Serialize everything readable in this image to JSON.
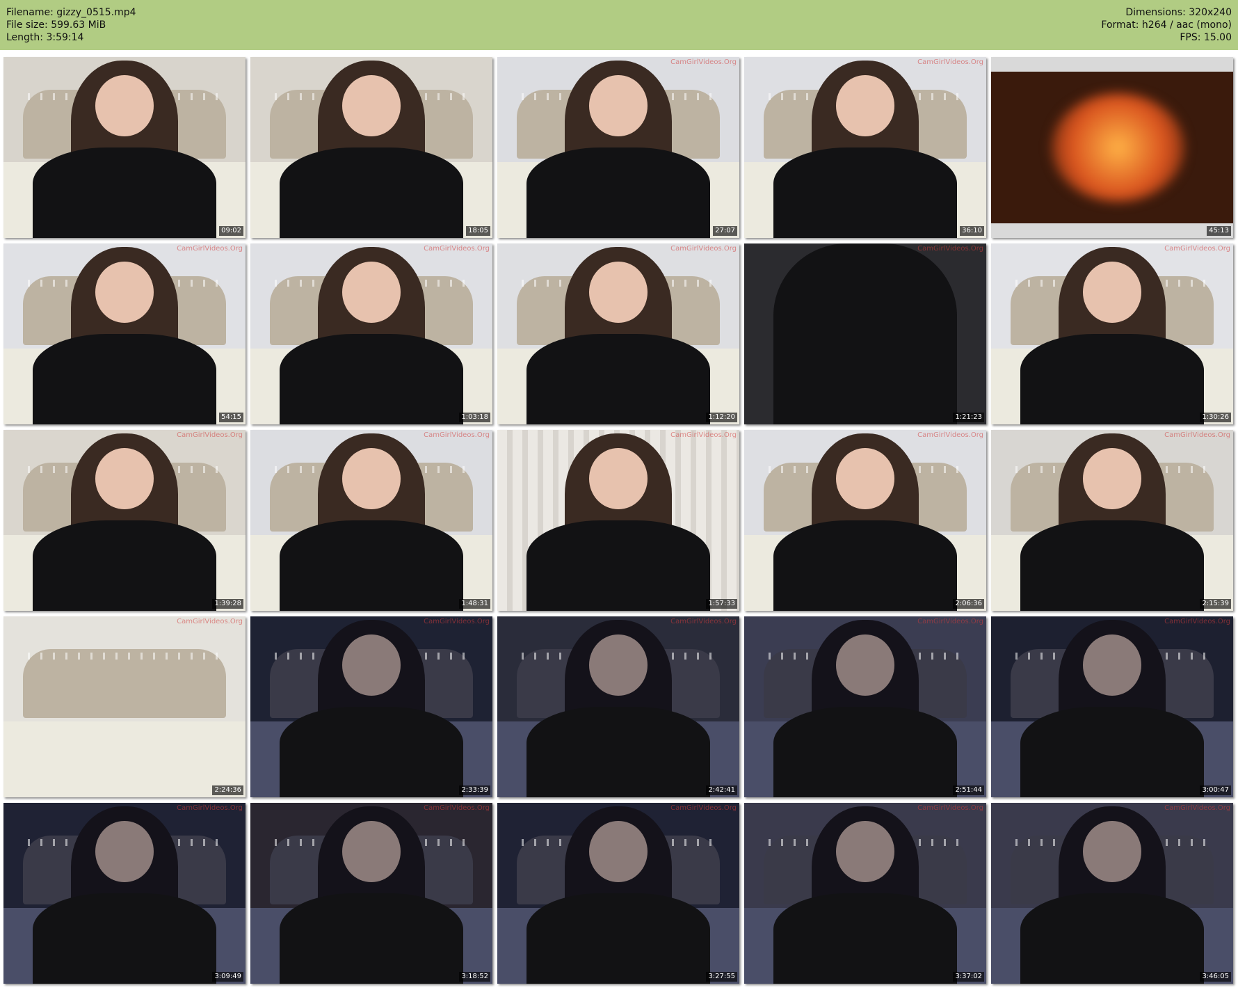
{
  "header": {
    "filename": "Filename: gizzy_0515.mp4",
    "filesize": "File size: 599.63 MiB",
    "length": "Length: 3:59:14",
    "dimensions": "Dimensions: 320x240",
    "format": "Format: h264 / aac (mono)",
    "fps": "FPS: 15.00"
  },
  "watermark_text": "CamGirlVideos.Org",
  "thumbnails": [
    {
      "ts": "09:02",
      "bg": "#d8d4cc",
      "tone": "light"
    },
    {
      "ts": "18:05",
      "bg": "#d9d5cd",
      "tone": "light"
    },
    {
      "ts": "27:07",
      "bg": "#dcdde1",
      "tone": "light"
    },
    {
      "ts": "36:10",
      "bg": "#dedfe3",
      "tone": "light"
    },
    {
      "ts": "45:13",
      "bg": "#2a2320",
      "tone": "fire"
    },
    {
      "ts": "54:15",
      "bg": "#e0e1e5",
      "tone": "light"
    },
    {
      "ts": "1:03:18",
      "bg": "#dfe0e4",
      "tone": "light"
    },
    {
      "ts": "1:12:20",
      "bg": "#dedfe2",
      "tone": "light"
    },
    {
      "ts": "1:21:23",
      "bg": "#2b2b2f",
      "tone": "dark"
    },
    {
      "ts": "1:30:26",
      "bg": "#e2e3e7",
      "tone": "light"
    },
    {
      "ts": "1:39:28",
      "bg": "#dad6ce",
      "tone": "light"
    },
    {
      "ts": "1:48:31",
      "bg": "#dcdde1",
      "tone": "light"
    },
    {
      "ts": "1:57:33",
      "bg": "#e6e3df",
      "tone": "curtain"
    },
    {
      "ts": "2:06:36",
      "bg": "#dedfe3",
      "tone": "light"
    },
    {
      "ts": "2:15:39",
      "bg": "#d8d6d2",
      "tone": "light"
    },
    {
      "ts": "2:24:36",
      "bg": "#e4e2dc",
      "tone": "bed"
    },
    {
      "ts": "2:33:39",
      "bg": "#1e2233",
      "tone": "night"
    },
    {
      "ts": "2:42:41",
      "bg": "#2a2c3a",
      "tone": "night"
    },
    {
      "ts": "2:51:44",
      "bg": "#3b3d52",
      "tone": "night"
    },
    {
      "ts": "3:00:47",
      "bg": "#1d2030",
      "tone": "night"
    },
    {
      "ts": "3:09:49",
      "bg": "#1f2234",
      "tone": "night"
    },
    {
      "ts": "3:18:52",
      "bg": "#2a2630",
      "tone": "night"
    },
    {
      "ts": "3:27:55",
      "bg": "#1f2234",
      "tone": "night"
    },
    {
      "ts": "3:37:02",
      "bg": "#3a3a4c",
      "tone": "night"
    },
    {
      "ts": "3:46:05",
      "bg": "#3a3a4c",
      "tone": "night"
    }
  ]
}
